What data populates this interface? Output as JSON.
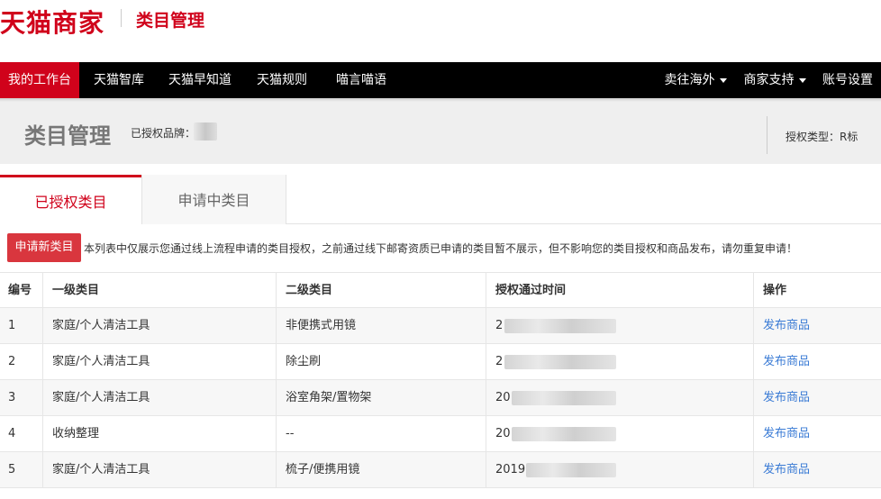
{
  "header": {
    "logo": "天猫商家",
    "subtitle": "类目管理"
  },
  "nav": {
    "items": [
      {
        "label": "我的工作台",
        "active": true
      },
      {
        "label": "天猫智库"
      },
      {
        "label": "天猫早知道"
      },
      {
        "label": "天猫规则"
      },
      {
        "label": "喵言喵语"
      }
    ],
    "right_items": [
      {
        "label": "卖往海外",
        "dropdown": true
      },
      {
        "label": "商家支持",
        "dropdown": true
      },
      {
        "label": "账号设置"
      }
    ]
  },
  "page": {
    "title": "类目管理",
    "brand_label": "已授权品牌：",
    "auth_type": "授权类型：R标"
  },
  "tabs": [
    {
      "label": "已授权类目",
      "active": true
    },
    {
      "label": "申请中类目"
    }
  ],
  "apply_button": "申请新类目",
  "notice": "本列表中仅展示您通过线上流程申请的类目授权，之前通过线下邮寄资质已申请的类目暂不展示，但不影响您的类目授权和商品发布，请勿重复申请！",
  "table": {
    "headers": [
      "编号",
      "一级类目",
      "二级类目",
      "授权通过时间",
      "操作"
    ],
    "rows": [
      {
        "no": "1",
        "cat1": "家庭/个人清洁工具",
        "cat2": "非便携式用镜",
        "time": "2",
        "action": "发布商品"
      },
      {
        "no": "2",
        "cat1": "家庭/个人清洁工具",
        "cat2": "除尘刷",
        "time": "2",
        "action": "发布商品"
      },
      {
        "no": "3",
        "cat1": "家庭/个人清洁工具",
        "cat2": "浴室角架/置物架",
        "time": "20",
        "action": "发布商品"
      },
      {
        "no": "4",
        "cat1": "收纳整理",
        "cat2": "--",
        "time": "20",
        "action": "发布商品"
      },
      {
        "no": "5",
        "cat1": "家庭/个人清洁工具",
        "cat2": "梳子/便携用镜",
        "time": "2019",
        "action": "发布商品"
      }
    ]
  },
  "colors": {
    "brand_red": "#d0021b",
    "nav_bg": "#000000",
    "link_blue": "#3a7bd5"
  }
}
